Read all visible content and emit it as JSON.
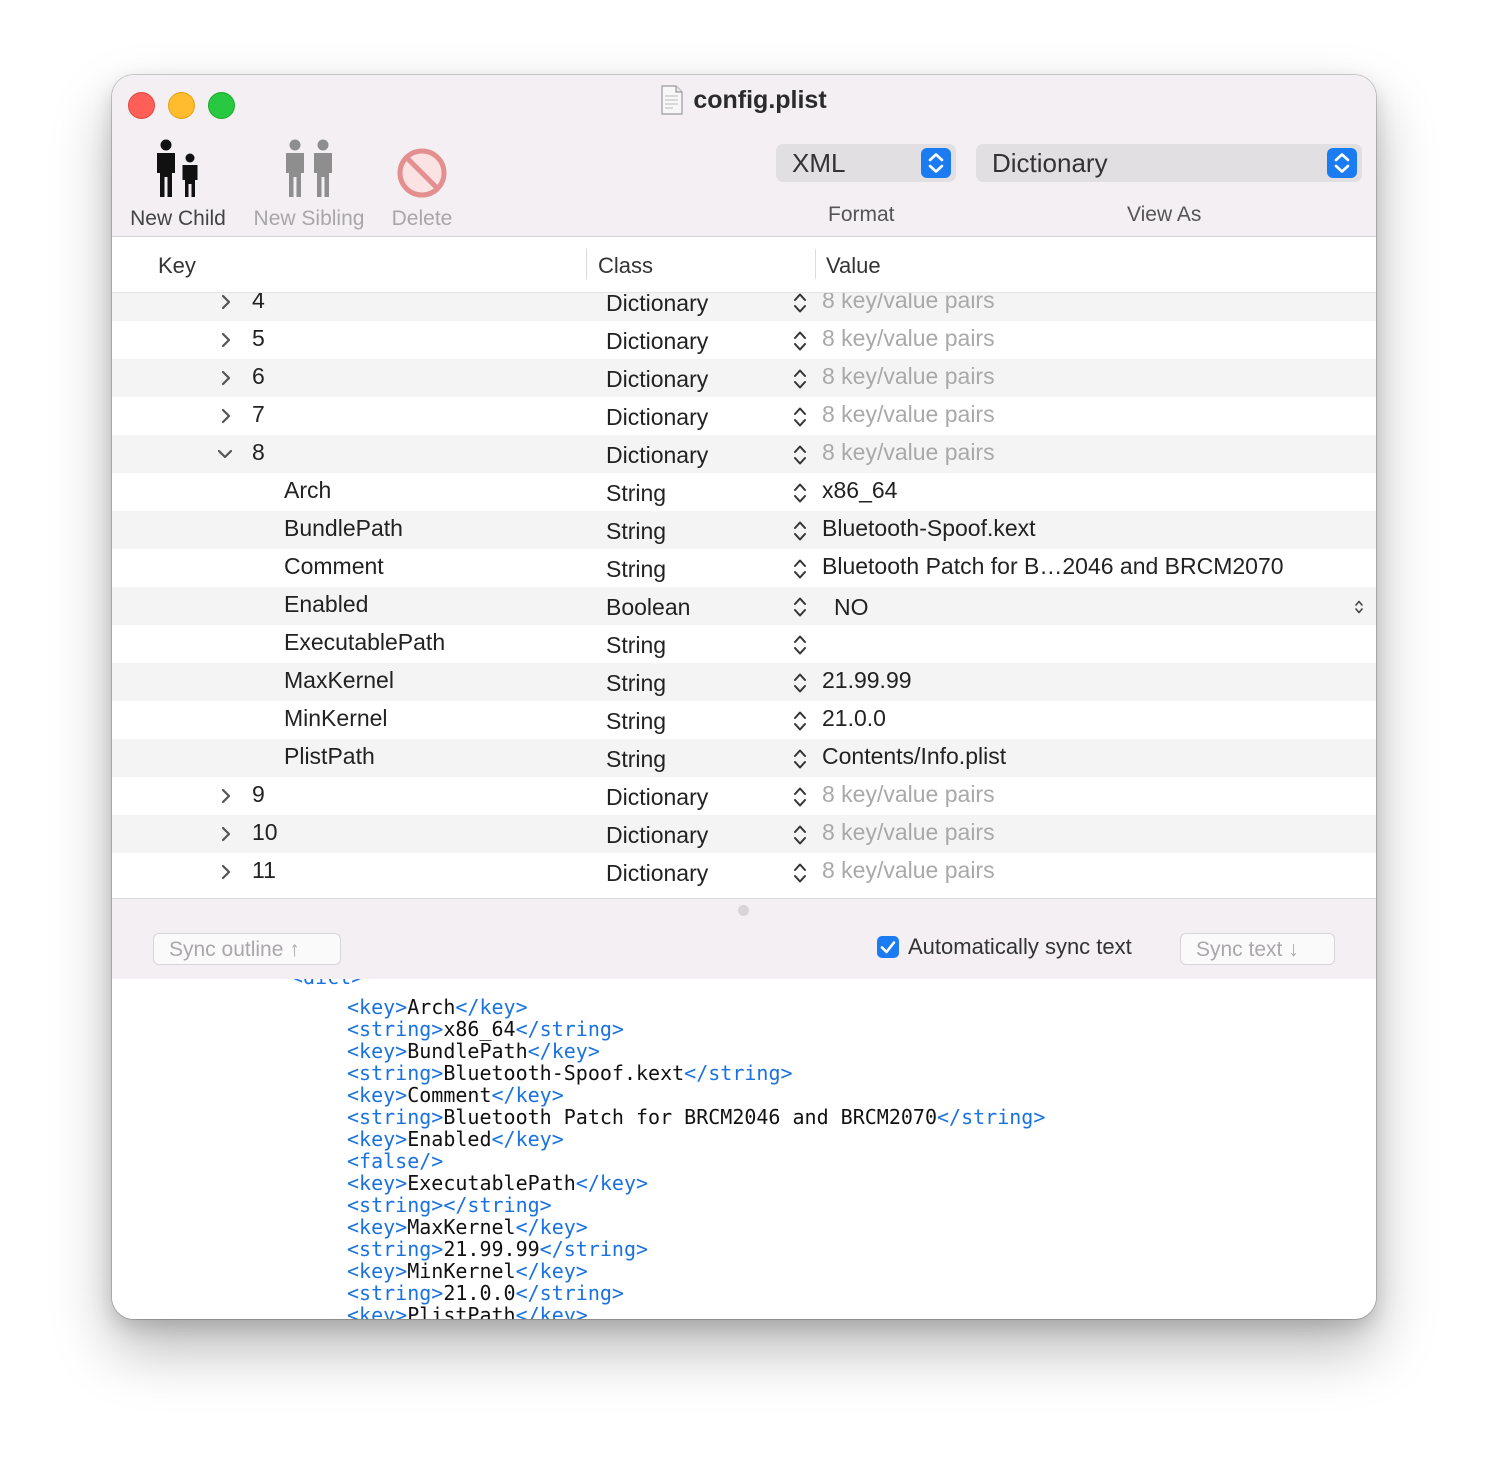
{
  "window": {
    "title": "config.plist"
  },
  "toolbar": {
    "new_child": "New Child",
    "new_sibling": "New Sibling",
    "delete": "Delete",
    "format_value": "XML",
    "format_label": "Format",
    "view_as_value": "Dictionary",
    "view_as_label": "View As"
  },
  "columns": {
    "key": "Key",
    "class": "Class",
    "value": "Value"
  },
  "rows": [
    {
      "key": "4",
      "class": "Dictionary",
      "value": "8 key/value pairs"
    },
    {
      "key": "5",
      "class": "Dictionary",
      "value": "8 key/value pairs"
    },
    {
      "key": "6",
      "class": "Dictionary",
      "value": "8 key/value pairs"
    },
    {
      "key": "7",
      "class": "Dictionary",
      "value": "8 key/value pairs"
    },
    {
      "key": "8",
      "class": "Dictionary",
      "value": "8 key/value pairs",
      "expanded": true
    },
    {
      "key": "Arch",
      "class": "String",
      "value": "x86_64"
    },
    {
      "key": "BundlePath",
      "class": "String",
      "value": "Bluetooth-Spoof.kext"
    },
    {
      "key": "Comment",
      "class": "String",
      "value": "Bluetooth Patch for B…2046 and BRCM2070"
    },
    {
      "key": "Enabled",
      "class": "Boolean",
      "value": "NO"
    },
    {
      "key": "ExecutablePath",
      "class": "String",
      "value": ""
    },
    {
      "key": "MaxKernel",
      "class": "String",
      "value": "21.99.99"
    },
    {
      "key": "MinKernel",
      "class": "String",
      "value": "21.0.0"
    },
    {
      "key": "PlistPath",
      "class": "String",
      "value": "Contents/Info.plist"
    },
    {
      "key": "9",
      "class": "Dictionary",
      "value": "8 key/value pairs"
    },
    {
      "key": "10",
      "class": "Dictionary",
      "value": "8 key/value pairs"
    },
    {
      "key": "11",
      "class": "Dictionary",
      "value": "8 key/value pairs"
    }
  ],
  "sync": {
    "sync_outline": "Sync outline ↑",
    "auto_sync": "Automatically sync text",
    "auto_sync_checked": true,
    "sync_text": "Sync text ↓"
  },
  "code": {
    "top_partial": "<dict>",
    "lines": [
      {
        "open": "<key>",
        "text": "Arch",
        "close": "</key>"
      },
      {
        "open": "<string>",
        "text": "x86_64",
        "close": "</string>"
      },
      {
        "open": "<key>",
        "text": "BundlePath",
        "close": "</key>"
      },
      {
        "open": "<string>",
        "text": "Bluetooth-Spoof.kext",
        "close": "</string>"
      },
      {
        "open": "<key>",
        "text": "Comment",
        "close": "</key>"
      },
      {
        "open": "<string>",
        "text": "Bluetooth Patch for BRCM2046 and BRCM2070",
        "close": "</string>"
      },
      {
        "open": "<key>",
        "text": "Enabled",
        "close": "</key>"
      },
      {
        "open": "<false/>",
        "text": "",
        "close": ""
      },
      {
        "open": "<key>",
        "text": "ExecutablePath",
        "close": "</key>"
      },
      {
        "open": "<string>",
        "text": "",
        "close": "</string>"
      },
      {
        "open": "<key>",
        "text": "MaxKernel",
        "close": "</key>"
      },
      {
        "open": "<string>",
        "text": "21.99.99",
        "close": "</string>"
      },
      {
        "open": "<key>",
        "text": "MinKernel",
        "close": "</key>"
      },
      {
        "open": "<string>",
        "text": "21.0.0",
        "close": "</string>"
      },
      {
        "open": "<key>",
        "text": "PlistPath",
        "close": "</key>"
      }
    ]
  },
  "colors": {
    "accent": "#1b7cf2",
    "xml_tag": "#1a72e0",
    "close": "#ff5f57",
    "minimize": "#febc2e",
    "zoom": "#28c840"
  }
}
